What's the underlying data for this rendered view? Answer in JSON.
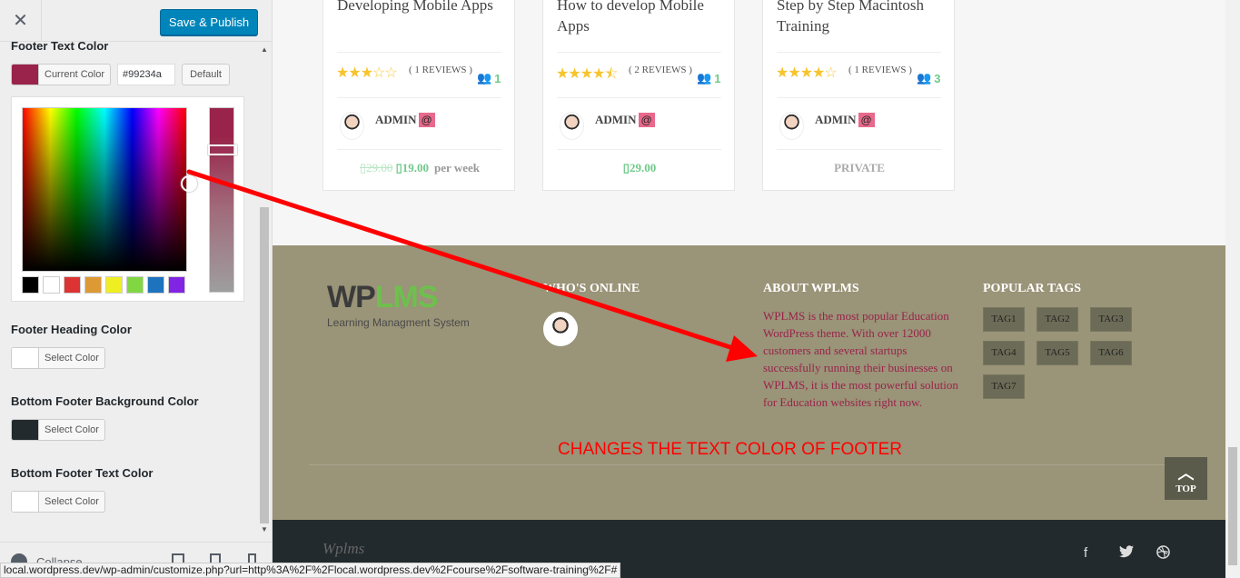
{
  "sidebar": {
    "close_glyph": "✕",
    "publish_label": "Save & Publish",
    "footer_text_color": {
      "label": "Footer Text Color",
      "current_label": "Current Color",
      "hex_value": "#99234a",
      "default_label": "Default",
      "swatch_color": "#99234a"
    },
    "palette": [
      "#000000",
      "#ffffff",
      "#dd3333",
      "#dd9933",
      "#eeee22",
      "#81d742",
      "#1e73be",
      "#8224e3"
    ],
    "footer_heading_color": {
      "label": "Footer Heading Color",
      "button_label": "Select Color",
      "swatch_color": "#ffffff"
    },
    "bottom_footer_bg_color": {
      "label": "Bottom Footer Background Color",
      "button_label": "Select Color",
      "swatch_color": "#232a2d"
    },
    "bottom_footer_text_color": {
      "label": "Bottom Footer Text Color",
      "button_label": "Select Color",
      "swatch_color": "#ffffff"
    },
    "collapse_label": "Collapse"
  },
  "courses": [
    {
      "title": "Developing Mobile Apps",
      "rating": "3",
      "reviews": "( 1 REVIEWS )",
      "students": "1",
      "author": "ADMIN",
      "at": "@",
      "old_price": "29.00",
      "price": "19.00",
      "per": "per week",
      "currency": ""
    },
    {
      "title": "How to develop Mobile Apps",
      "rating": "4.5",
      "reviews": "( 2 REVIEWS )",
      "students": "1",
      "author": "ADMIN",
      "at": "@",
      "price": "29.00",
      "currency": ""
    },
    {
      "title": "Step by Step Macintosh Training",
      "rating": "4",
      "reviews": "( 1 REVIEWS )",
      "students": "3",
      "author": "ADMIN",
      "at": "@",
      "price_label": "PRIVATE"
    }
  ],
  "footer": {
    "logo_wp": "WP",
    "logo_lms": "LMS",
    "logo_tagline": "Learning Managment System",
    "whos_online": "WHO'S ONLINE",
    "about_heading": "ABOUT WPLMS",
    "about_text": "WPLMS is the most popular Education WordPress theme. With over 12000 customers and several startups successfully running their businesses on WPLMS, it is the most powerful solution for Education websites right now.",
    "tags_heading": "POPULAR TAGS",
    "tags": [
      "TAG1",
      "TAG2",
      "TAG3",
      "TAG4",
      "TAG5",
      "TAG6",
      "TAG7"
    ],
    "annotation": "CHANGES THE TEXT COLOR OF FOOTER",
    "top_label": "TOP",
    "text_color": "#99234a",
    "background": "#9a9478"
  },
  "bottom_footer": {
    "logo": "Wplms",
    "social": [
      "facebook-icon",
      "twitter-icon",
      "dribbble-icon"
    ]
  },
  "status_bar": "local.wordpress.dev/wp-admin/customize.php?url=http%3A%2F%2Flocal.wordpress.dev%2Fcourse%2Fsoftware-training%2F#"
}
